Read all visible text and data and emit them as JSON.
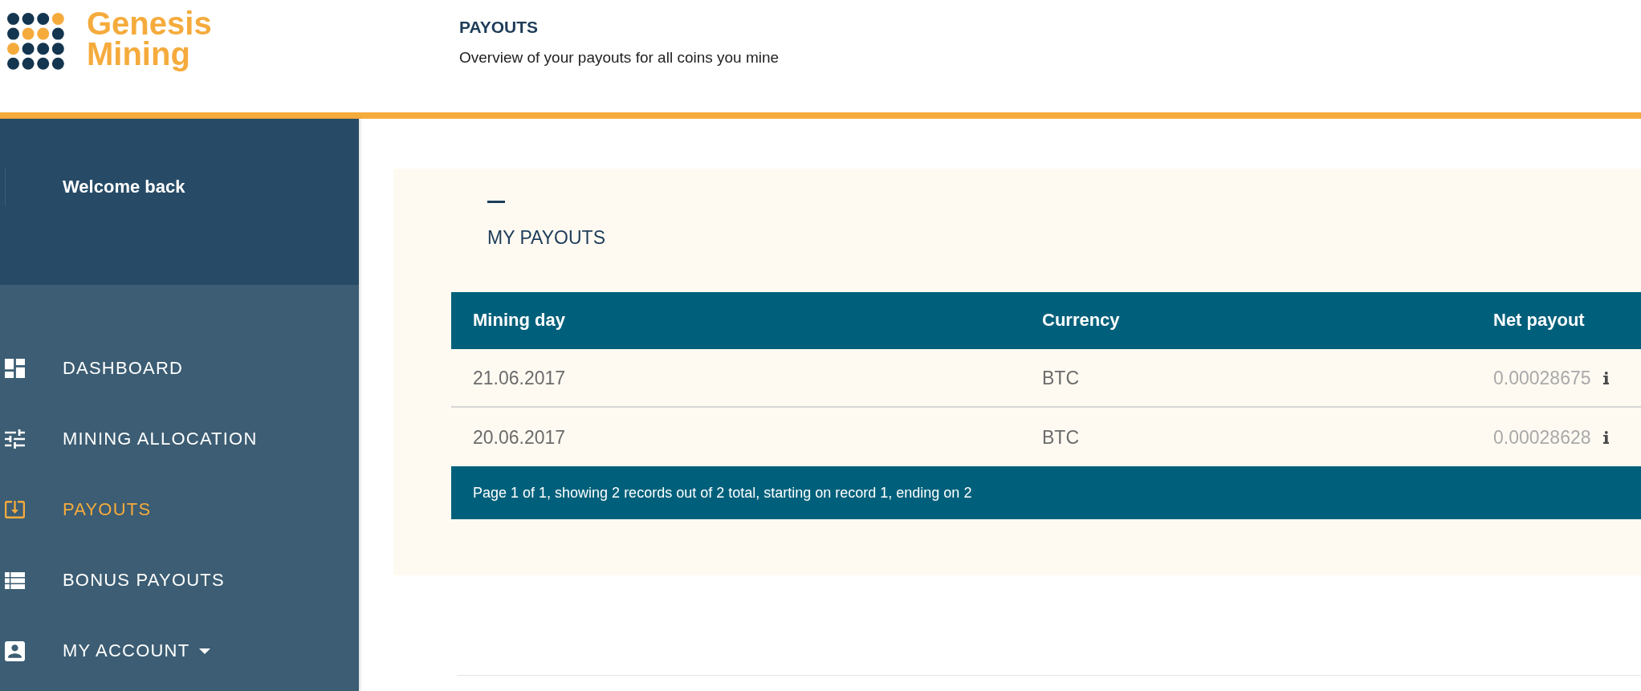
{
  "logo": {
    "name": "Genesis Mining"
  },
  "header": {
    "title": "PAYOUTS",
    "subtitle": "Overview of your payouts for all coins you mine"
  },
  "sidebar": {
    "greeting": "Welcome back",
    "items": [
      {
        "label": "DASHBOARD",
        "selected": false,
        "dropdown": false
      },
      {
        "label": "MINING ALLOCATION",
        "selected": false,
        "dropdown": false
      },
      {
        "label": "PAYOUTS",
        "selected": true,
        "dropdown": false
      },
      {
        "label": "BONUS PAYOUTS",
        "selected": false,
        "dropdown": false
      },
      {
        "label": "MY ACCOUNT",
        "selected": false,
        "dropdown": true
      }
    ]
  },
  "card": {
    "title": "MY PAYOUTS",
    "table": {
      "columns": [
        "Mining day",
        "Currency",
        "Net payout"
      ],
      "rows": [
        {
          "cells": [
            "21.06.2017",
            "BTC",
            "0.00028675"
          ]
        },
        {
          "cells": [
            "20.06.2017",
            "BTC",
            "0.00028628"
          ]
        }
      ],
      "footer": "Page 1 of 1, showing 2 records out of 2 total, starting on record 1, ending on 2"
    }
  }
}
